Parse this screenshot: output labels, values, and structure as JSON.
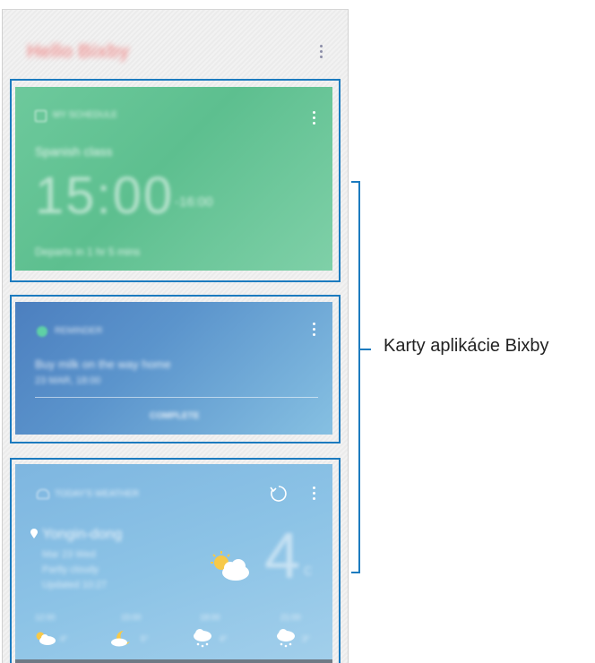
{
  "header": {
    "title": "Hello Bixby"
  },
  "card_calendar": {
    "app": "MY SCHEDULE",
    "event": "Spanish class",
    "start_time": "15:00",
    "end_time": "-16:00",
    "footer": "Departs in 1 hr 5 mins"
  },
  "card_reminder": {
    "app": "REMINDER",
    "text": "Buy milk on the way home",
    "datetime": "23 MAR, 18:00",
    "action": "COMPLETE"
  },
  "card_weather": {
    "app": "TODAY'S WEATHER",
    "location": "Yongin-dong",
    "detail_1": "Mar 23 Wed",
    "detail_2": "Partly cloudy",
    "detail_3": "Updated 10:27",
    "temperature": "4",
    "unit": "c",
    "forecast": [
      {
        "time": "12:00",
        "temp": "4°",
        "icon": "partly-cloudy-icon"
      },
      {
        "time": "15:00",
        "temp": "5°",
        "icon": "moon-cloud-icon"
      },
      {
        "time": "18:00",
        "temp": "4°",
        "icon": "cloud-snow-icon"
      },
      {
        "time": "21:00",
        "temp": "3°",
        "icon": "cloud-snow-icon"
      }
    ]
  },
  "callout": {
    "label": "Karty aplikácie Bixby"
  },
  "colors": {
    "outline": "#1c7bbf",
    "card_calendar": "#6dc99c",
    "card_reminder": "#5b94cc",
    "card_weather": "#8cc3e6"
  }
}
